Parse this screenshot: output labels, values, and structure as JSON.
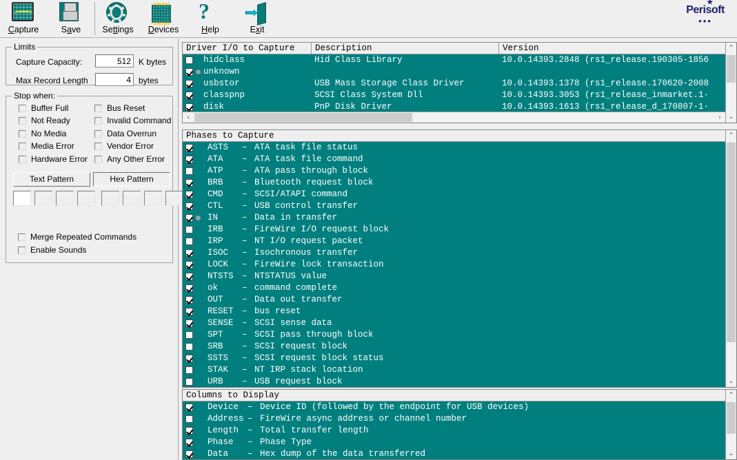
{
  "app": {
    "brand": "Perisoft",
    "brand_star": "★",
    "brand_dots": "•••",
    "brand_color": "#1d1d6e",
    "accent_teal": "#007f7e",
    "bg_gray": "#efefef"
  },
  "toolbar": {
    "items": [
      {
        "label": "Capture",
        "underline": "C",
        "icon": "oscilloscope-icon"
      },
      {
        "label": "Save",
        "underline": "a",
        "icon": "floppy-disk-icon"
      },
      {
        "label": "Settings",
        "underline": "tt",
        "icon": "gear-icon"
      },
      {
        "label": "Devices",
        "underline": "D",
        "icon": "chip-icon"
      },
      {
        "label": "Help",
        "underline": "H",
        "icon": "question-mark-icon"
      },
      {
        "label": "Exit",
        "underline": "x",
        "icon": "exit-door-icon"
      }
    ]
  },
  "limits": {
    "legend": "Limits",
    "capacity_label": "Capture Capacity:",
    "capacity_value": "512",
    "capacity_unit": "K bytes",
    "record_label": "Max Record Length",
    "record_value": "4",
    "record_unit": "bytes"
  },
  "stop_when": {
    "legend": "Stop when:",
    "left_column": [
      {
        "label": "Buffer Full",
        "checked": false
      },
      {
        "label": "Not Ready",
        "checked": false
      },
      {
        "label": "No Media",
        "checked": false
      },
      {
        "label": "Media Error",
        "checked": false
      },
      {
        "label": "Hardware Error",
        "checked": false
      }
    ],
    "right_column": [
      {
        "label": "Bus Reset",
        "checked": false
      },
      {
        "label": "Invalid Command",
        "checked": false
      },
      {
        "label": "Data Overrun",
        "checked": false
      },
      {
        "label": "Vendor Error",
        "checked": false
      },
      {
        "label": "Any Other Error",
        "checked": false
      }
    ],
    "text_pattern_button": "Text Pattern",
    "hex_pattern_button": "Hex Pattern",
    "selected_pattern_tab": "Hex Pattern",
    "pattern_cells_text": [
      "",
      "",
      "",
      ""
    ],
    "pattern_cells_hex": [
      "",
      "",
      "",
      ""
    ]
  },
  "options": [
    {
      "label": "Merge Repeated Commands",
      "checked": false
    },
    {
      "label": "Enable Sounds",
      "checked": false
    }
  ],
  "driver_panel": {
    "columns": [
      "Driver I/O to Capture",
      "Description",
      "Version"
    ],
    "rows": [
      {
        "checked": false,
        "dot": false,
        "name": "hidclass",
        "description": "Hid Class Library",
        "version": "10.0.14393.2848 (rs1_release.190305-1856"
      },
      {
        "checked": true,
        "dot": true,
        "name": "unknown",
        "description": "",
        "version": ""
      },
      {
        "checked": true,
        "dot": false,
        "name": "usbstor",
        "description": "USB Mass Storage Class Driver",
        "version": "10.0.14393.1378 (rs1_release.170620-2008"
      },
      {
        "checked": true,
        "dot": false,
        "name": "classpnp",
        "description": "SCSI Class System Dll",
        "version": "10.0.14393.3053 (rs1_release_inmarket.1·"
      },
      {
        "checked": true,
        "dot": false,
        "name": "disk",
        "description": "PnP Disk Driver",
        "version": "10.0.14393.1613 (rs1_release_d_170807-1·"
      }
    ],
    "scroll_left_arrow": "‹",
    "scroll_right_arrow": "›",
    "scroll_up_arrow": "⌃",
    "scroll_down_arrow": "⌄"
  },
  "phases_panel": {
    "header": "Phases to Capture",
    "rows": [
      {
        "checked": true,
        "dot": false,
        "code": "ASTS",
        "dash": "–",
        "desc": "ATA task file status"
      },
      {
        "checked": true,
        "dot": false,
        "code": "ATA",
        "dash": "–",
        "desc": "ATA task file command"
      },
      {
        "checked": false,
        "dot": false,
        "code": "ATP",
        "dash": "–",
        "desc": "ATA pass through block"
      },
      {
        "checked": true,
        "dot": false,
        "code": "BRB",
        "dash": "–",
        "desc": "Bluetooth request block"
      },
      {
        "checked": true,
        "dot": false,
        "code": "CMD",
        "dash": "–",
        "desc": "SCSI/ATAPI command"
      },
      {
        "checked": true,
        "dot": false,
        "code": "CTL",
        "dash": "–",
        "desc": "USB control transfer"
      },
      {
        "checked": true,
        "dot": true,
        "code": "IN",
        "dash": "–",
        "desc": "Data in transfer"
      },
      {
        "checked": false,
        "dot": false,
        "code": "IRB",
        "dash": "–",
        "desc": "FireWire I/O request block"
      },
      {
        "checked": false,
        "dot": false,
        "code": "IRP",
        "dash": "–",
        "desc": "NT I/O request packet"
      },
      {
        "checked": true,
        "dot": false,
        "code": "ISOC",
        "dash": "–",
        "desc": "Isochronous transfer"
      },
      {
        "checked": true,
        "dot": false,
        "code": "LOCK",
        "dash": "–",
        "desc": "FireWire lock transaction"
      },
      {
        "checked": true,
        "dot": false,
        "code": "NTSTS",
        "dash": "–",
        "desc": "NTSTATUS value"
      },
      {
        "checked": true,
        "dot": false,
        "code": "ok",
        "dash": "–",
        "desc": "command complete"
      },
      {
        "checked": true,
        "dot": false,
        "code": "OUT",
        "dash": "–",
        "desc": "Data out transfer"
      },
      {
        "checked": true,
        "dot": false,
        "code": "RESET",
        "dash": "–",
        "desc": "bus reset"
      },
      {
        "checked": true,
        "dot": false,
        "code": "SENSE",
        "dash": "–",
        "desc": "SCSI sense data"
      },
      {
        "checked": false,
        "dot": false,
        "code": "SPT",
        "dash": "–",
        "desc": "SCSI pass through block"
      },
      {
        "checked": false,
        "dot": false,
        "code": "SRB",
        "dash": "–",
        "desc": "SCSI request block"
      },
      {
        "checked": true,
        "dot": false,
        "code": "SSTS",
        "dash": "–",
        "desc": "SCSI request block status"
      },
      {
        "checked": false,
        "dot": false,
        "code": "STAK",
        "dash": "–",
        "desc": "NT IRP stack location"
      },
      {
        "checked": false,
        "dot": false,
        "code": "URB",
        "dash": "–",
        "desc": "USB request block"
      }
    ]
  },
  "columns_panel": {
    "header": "Columns to Display",
    "rows": [
      {
        "checked": true,
        "code": "Device",
        "dash": "–",
        "desc": "Device ID (followed by the endpoint for USB devices)"
      },
      {
        "checked": false,
        "code": "Address",
        "dash": "–",
        "desc": "FireWire async address or channel number"
      },
      {
        "checked": true,
        "code": "Length",
        "dash": "–",
        "desc": "Total transfer length"
      },
      {
        "checked": true,
        "code": "Phase",
        "dash": "–",
        "desc": "Phase Type"
      },
      {
        "checked": true,
        "code": "Data",
        "dash": "–",
        "desc": "Hex dump of the data transferred"
      }
    ]
  }
}
